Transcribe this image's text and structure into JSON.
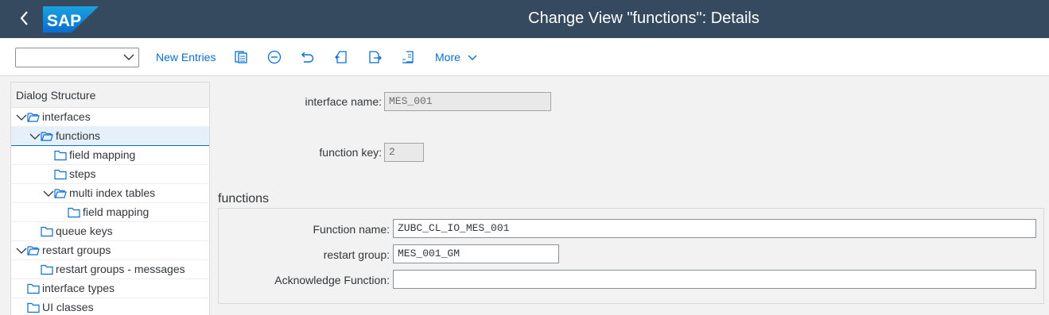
{
  "shell": {
    "title": "Change View \"functions\": Details",
    "logo_text": "SAP",
    "brand_color": "#354a5f",
    "back_icon": "chevron-left-icon"
  },
  "toolbar": {
    "select_value": "",
    "new_entries_label": "New Entries",
    "icons": [
      "copy-as-icon",
      "delete-icon",
      "undo-icon",
      "previous-entry-icon",
      "next-entry-icon",
      "select-block-icon"
    ],
    "more_label": "More"
  },
  "tree": {
    "header": "Dialog Structure",
    "items": [
      {
        "label": "interfaces",
        "level": 0,
        "expanded": true
      },
      {
        "label": "functions",
        "level": 1,
        "expanded": true,
        "selected": true
      },
      {
        "label": "field mapping",
        "level": 2
      },
      {
        "label": "steps",
        "level": 2
      },
      {
        "label": "multi index tables",
        "level": 2,
        "expanded": true
      },
      {
        "label": "field mapping",
        "level": 3
      },
      {
        "label": "queue keys",
        "level": 1
      },
      {
        "label": "restart groups",
        "level": 0,
        "expanded": true
      },
      {
        "label": "restart groups - messages",
        "level": 1
      },
      {
        "label": "interface types",
        "level": 0
      },
      {
        "label": "UI classes",
        "level": 0
      }
    ]
  },
  "form": {
    "interface_name_label": "interface name:",
    "interface_name_value": "MES_001",
    "function_key_label": "function key:",
    "function_key_value": "2",
    "section_title": "functions",
    "function_name_label": "Function name:",
    "function_name_value": "ZUBC_CL_IO_MES_001",
    "restart_group_label": "restart group:",
    "restart_group_value": "MES_001_GM",
    "ack_function_label": "Acknowledge Function:",
    "ack_function_value": ""
  }
}
